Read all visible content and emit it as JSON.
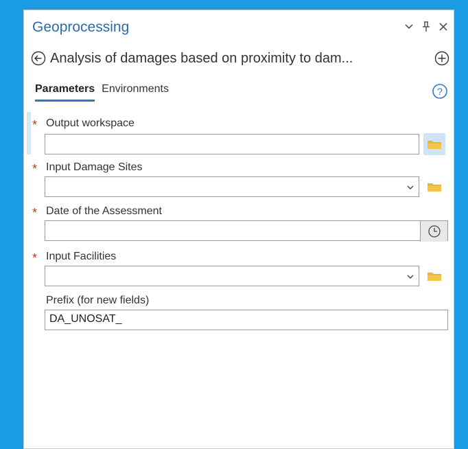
{
  "pane": {
    "title": "Geoprocessing",
    "tool_title": "Analysis of damages based on proximity to dam...",
    "tabs": [
      {
        "label": "Parameters",
        "active": true
      },
      {
        "label": "Environments",
        "active": false
      }
    ]
  },
  "parameters": [
    {
      "label": "Output workspace",
      "required": true,
      "type": "workspace",
      "value": ""
    },
    {
      "label": "Input Damage Sites",
      "required": true,
      "type": "dropdown",
      "value": ""
    },
    {
      "label": "Date of the Assessment",
      "required": true,
      "type": "date",
      "value": ""
    },
    {
      "label": "Input Facilities",
      "required": true,
      "type": "dropdown",
      "value": ""
    },
    {
      "label": "Prefix (for new fields)",
      "required": false,
      "type": "text",
      "value": "DA_UNOSAT_"
    }
  ],
  "icons": {
    "back": "back-arrow-circle-icon",
    "add": "plus-circle-icon",
    "help": "help-question-icon",
    "folder": "folder-icon",
    "clock": "clock-icon"
  },
  "colors": {
    "background": "#1a9be4",
    "title": "#2d6ca8",
    "required": "#c0392b",
    "tab_underline": "#2d7ac2",
    "folder": "#f3c64a"
  }
}
